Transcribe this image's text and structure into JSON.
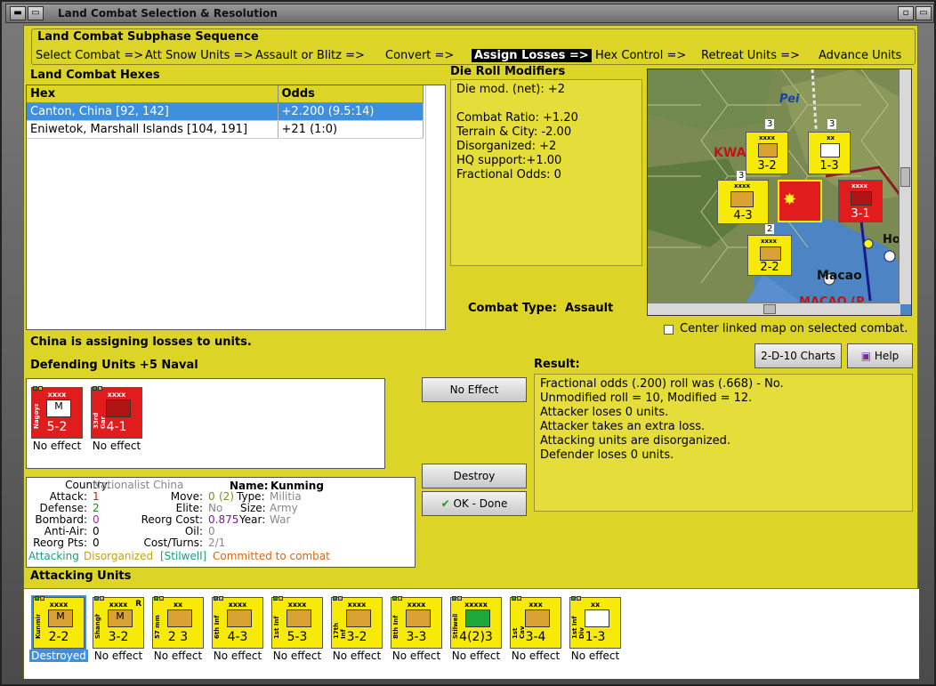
{
  "window": {
    "title": "Land Combat Selection & Resolution"
  },
  "phase_bar": {
    "title": "Land Combat Subphase Sequence",
    "phases": [
      "Select Combat =>",
      "Att Snow Units =>",
      "Assault or Blitz =>",
      "Convert =>",
      "Assign Losses =>",
      "Hex Control =>",
      "Retreat Units =>",
      "Advance Units"
    ],
    "active_index": 4
  },
  "hexes": {
    "title": "Land Combat Hexes",
    "columns": [
      "Hex",
      "Odds"
    ],
    "rows": [
      {
        "hex": "Canton, China [92, 142]",
        "odds": "+2.200 (9.5:14)"
      },
      {
        "hex": "Eniwetok, Marshall Islands [104, 191]",
        "odds": "+21 (1:0)"
      }
    ]
  },
  "modifiers": {
    "title": "Die Roll Modifiers",
    "lines": [
      "Die mod. (net): +2",
      "",
      "Combat Ratio: +1.20",
      "Terrain & City: -2.00",
      "Disorganized: +2",
      "HQ support:+1.00",
      "Fractional Odds: 0"
    ]
  },
  "combat_type": {
    "label": "Combat Type:",
    "value": "Assault"
  },
  "map": {
    "labels": {
      "pei": "Pei",
      "kwang": "KWA  NG",
      "macao": "Macao",
      "macao2": "MACAO (P",
      "hong": "Ho",
      "antor": "Canton"
    },
    "units": [
      {
        "label": "xxxx",
        "str": "3-2",
        "side": "12th Inf"
      },
      {
        "label": "xx",
        "str": "1-3",
        "side": "1st Inf"
      },
      {
        "label": "xxxx",
        "str": "4-3",
        "side": "8th Inf"
      },
      {
        "label": "xxxx",
        "str": "3-1",
        "side": "Canton"
      },
      {
        "label": "xxxx",
        "str": "2-2",
        "side": "Kunming"
      }
    ],
    "stack_counts": [
      "3",
      "3",
      "3",
      "2",
      "3"
    ],
    "center_label": "Center linked map on selected combat."
  },
  "status_text": "China is assigning losses to units.",
  "defending": {
    "title": "Defending Units +5 Naval",
    "units": [
      {
        "top": "xxxx",
        "side": "Nagoya",
        "str": "5-2",
        "result": "No effect",
        "sym": "M"
      },
      {
        "top": "xxxx",
        "side": "33rd Gar",
        "str": "4-1",
        "result": "No effect",
        "sym": ""
      }
    ]
  },
  "buttons": {
    "charts": "2-D-10 Charts",
    "help": "Help",
    "no_effect": "No Effect",
    "destroy": "Destroy",
    "ok_done": "OK - Done"
  },
  "result": {
    "title": "Result:",
    "lines": [
      "Fractional odds (.200) roll was (.668)  - No.",
      "Unmodified roll = 10, Modified = 12.",
      "Attacker loses 0 units.",
      "Attacker takes an extra loss.",
      "Attacking units are disorganized.",
      "Defender loses 0 units."
    ]
  },
  "unit_info": {
    "country_label": "Country:",
    "country": "Nationalist China",
    "name_label": "Name:",
    "name": "Kunming",
    "attack_label": "Attack:",
    "attack": "1",
    "move_label": "Move:",
    "move_a": "0",
    "move_b": "(2)",
    "type_label": "Type:",
    "type": "Militia",
    "defense_label": "Defense:",
    "defense": "2",
    "elite_label": "Elite:",
    "elite": "No",
    "size_label": "Size:",
    "size": "Army",
    "bombard_label": "Bombard:",
    "bombard": "0",
    "reorg_label": "Reorg Cost:",
    "reorg": "0.875",
    "year_label": "Year:",
    "year": "War",
    "aa_label": "Anti-Air:",
    "aa": "0",
    "oil_label": "Oil:",
    "oil": "0",
    "rpts_label": "Reorg Pts:",
    "rpts": "0",
    "cost_label": "Cost/Turns:",
    "cost": "2/1",
    "status_attacking": "Attacking",
    "status_disorg": "Disorganized",
    "status_stilwell": "[Stilwell]",
    "status_committed": "Committed to combat"
  },
  "attacking": {
    "title": "Attacking Units",
    "units": [
      {
        "top": "xxxx",
        "side": "Kunming",
        "str": "2-2",
        "result": "Destroyed",
        "sym": "M",
        "color": "#f7ea06",
        "selected": true
      },
      {
        "top": "xxxx",
        "side": "Shanghai",
        "str": "3-2",
        "result": "No effect",
        "sym": "M",
        "color": "#f7ea06",
        "r": "R"
      },
      {
        "top": "xx",
        "side": "57 mm",
        "str": "2 3",
        "result": "No effect",
        "sym": "A",
        "color": "#f7ea06"
      },
      {
        "top": "xxxx",
        "side": "6th Inf",
        "str": "4-3",
        "result": "No effect",
        "sym": "",
        "color": "#f7ea06"
      },
      {
        "top": "xxxx",
        "side": "1st Inf",
        "str": "5-3",
        "result": "No effect",
        "sym": "",
        "color": "#f7ea06"
      },
      {
        "top": "xxxx",
        "side": "17th Inf",
        "str": "3-2",
        "result": "No effect",
        "sym": "",
        "color": "#f7ea06"
      },
      {
        "top": "xxxx",
        "side": "8th Inf",
        "str": "3-3",
        "result": "No effect",
        "sym": "",
        "color": "#f7ea06"
      },
      {
        "top": "xxxxx",
        "side": "Stilwell",
        "str": "4(2)3",
        "result": "No effect",
        "sym": "",
        "color": "#f7ea06"
      },
      {
        "top": "xxx",
        "side": "1st Cav",
        "str": "3-4",
        "result": "No effect",
        "sym": "/",
        "color": "#f7ea06"
      },
      {
        "top": "xx",
        "side": "1st Inf Div",
        "str": "1-3",
        "result": "No effect",
        "sym": "X",
        "color": "#f7ea06"
      }
    ]
  }
}
